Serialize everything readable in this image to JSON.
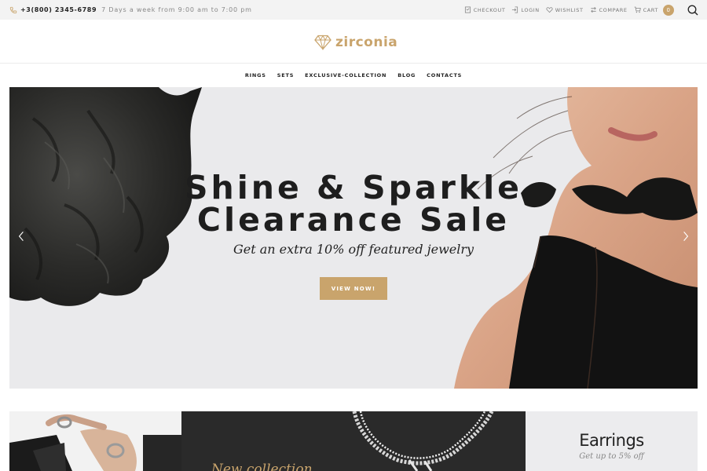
{
  "colors": {
    "accent": "#c9a46c",
    "topbar_bg": "#f3f3f3",
    "hero_bg": "#eaeaec",
    "dark": "#222222"
  },
  "topbar": {
    "phone_icon": "phone-icon",
    "phone": "+3(800) 2345-6789",
    "hours": "7 Days a week from 9:00 am to 7:00 pm",
    "links": {
      "checkout": "CHECKOUT",
      "login": "LOGIN",
      "wishlist": "WISHLIST",
      "compare": "COMPARE",
      "cart": "CART"
    },
    "cart_count": "0",
    "search_icon": "search-icon"
  },
  "logo": {
    "text": "zirconia",
    "icon": "diamond-icon"
  },
  "nav": {
    "items": [
      "RINGS",
      "SETS",
      "EXCLUSIVE-COLLECTION",
      "BLOG",
      "CONTACTS"
    ]
  },
  "hero": {
    "title_line1": "Shine & Sparkle",
    "title_line2": "Clearance Sale",
    "subtitle": "Get an extra 10% off featured jewelry",
    "button": "VIEW NOW!"
  },
  "banners": {
    "collection_title": "New collection",
    "earrings_title": "Earrings",
    "earrings_sub": "Get up to 5% off"
  }
}
